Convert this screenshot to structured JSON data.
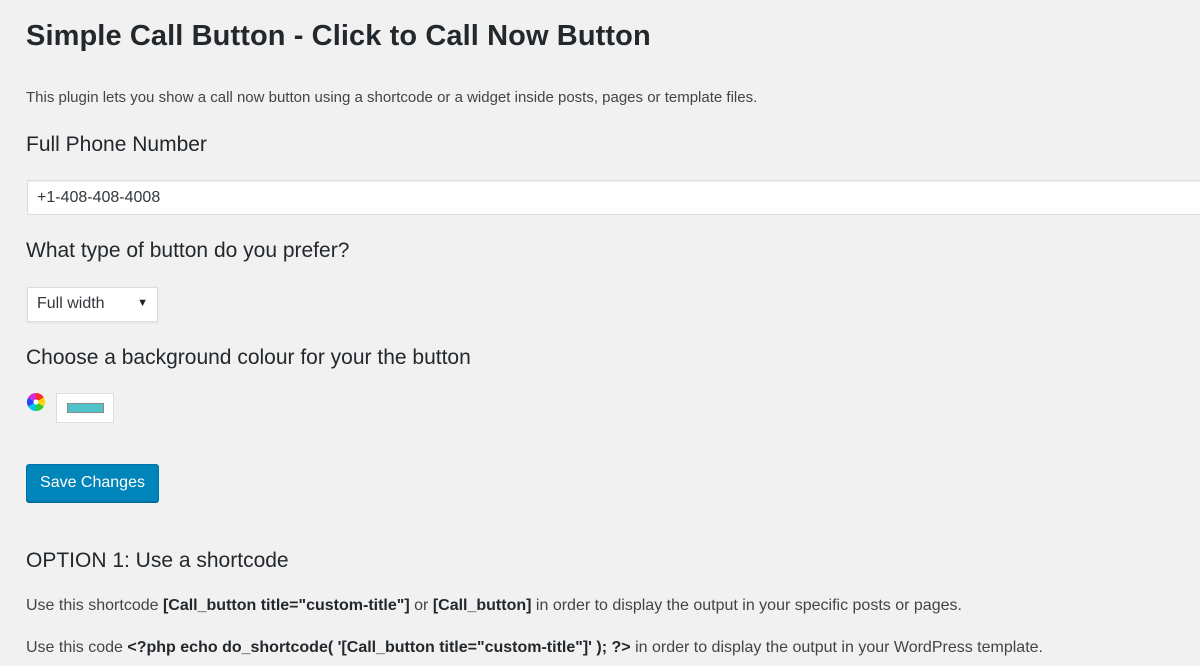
{
  "page": {
    "title": "Simple Call Button - Click to Call Now Button",
    "intro": "This plugin lets you show a call now button using a shortcode or a widget inside posts, pages or template files."
  },
  "phone": {
    "label": "Full Phone Number",
    "value": "+1-408-408-4008"
  },
  "button_type": {
    "label": "What type of button do you prefer?",
    "selected": "Full width",
    "arrow": "▼"
  },
  "background": {
    "label": "Choose a background colour for your the button",
    "picker_icon": "color-wheel-icon",
    "swatch_color": "#4fc3c7"
  },
  "actions": {
    "save_label": "Save Changes"
  },
  "option1": {
    "heading": "OPTION 1: Use a shortcode",
    "line1_prefix": "Use this shortcode ",
    "line1_code1": "[Call_button title=\"custom-title\"]",
    "line1_or": " or ",
    "line1_code2": "[Call_button]",
    "line1_suffix": " in order to display the output in your specific posts or pages.",
    "line2_prefix": "Use this code ",
    "line2_code": "<?php echo do_shortcode( '[Call_button title=\"custom-title\"]' ); ?>",
    "line2_suffix": " in order to display the output in your WordPress template."
  },
  "colors": {
    "primary_button": "#0085ba",
    "page_background": "#f1f1f1"
  }
}
